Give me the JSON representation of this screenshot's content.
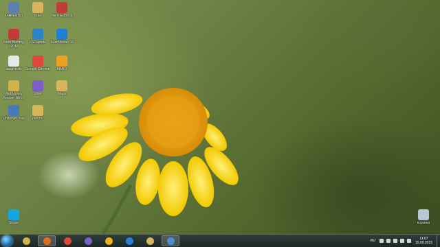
{
  "desktop": {
    "icons": [
      {
        "label": "Компьютер",
        "icon": "computer-icon",
        "color": "#5b7fb0"
      },
      {
        "label": "скан",
        "icon": "folder-icon",
        "color": "#d8b45a"
      },
      {
        "label": "Nero Express",
        "icon": "nero-icon",
        "color": "#c23b3b"
      },
      {
        "label": "Nero Burning ROM",
        "icon": "nero-burning-rom-icon",
        "color": "#c23b3b"
      },
      {
        "label": "FSCapture",
        "icon": "fscapture-icon",
        "color": "#2a86c9"
      },
      {
        "label": "TeamViewer 10",
        "icon": "teamviewer-icon",
        "color": "#1f7fd6"
      },
      {
        "label": "задачи.txt",
        "icon": "text-file-icon",
        "color": "#e8e8e8"
      },
      {
        "label": "Google Chrome",
        "icon": "chrome-icon",
        "color": "#e0463a"
      },
      {
        "label": "AIMP3",
        "icon": "aimp-icon",
        "color": "#f0a020"
      },
      {
        "label": "WebMoney Keeper Win...",
        "icon": "webmoney-icon",
        "color": "#d2b04a"
      },
      {
        "label": "Viber",
        "icon": "viber-icon",
        "color": "#7b5ec6"
      },
      {
        "label": "Maps",
        "icon": "maps-icon",
        "color": "#d8b45a"
      },
      {
        "label": "Unknown Tool",
        "icon": "tool-icon",
        "color": "#4a78b8"
      },
      {
        "label": "работа",
        "icon": "folder-icon",
        "color": "#d8b45a"
      },
      {
        "label": "Skype",
        "icon": "skype-icon",
        "color": "#12a7e3"
      },
      {
        "label": "корзина",
        "icon": "recycle-bin-icon",
        "color": "#b8c7d3"
      }
    ]
  },
  "taskbar": {
    "apps": [
      {
        "name": "WebMoney",
        "icon": "webmoney-icon",
        "color": "#d2b04a",
        "active": false
      },
      {
        "name": "Firefox",
        "icon": "firefox-icon",
        "color": "#e66a1b",
        "active": true
      },
      {
        "name": "Google Chrome",
        "icon": "chrome-icon",
        "color": "#e0463a",
        "active": false
      },
      {
        "name": "Viber",
        "icon": "viber-icon",
        "color": "#7b5ec6",
        "active": false
      },
      {
        "name": "Messenger",
        "icon": "messenger-icon",
        "color": "#f0b020",
        "active": false
      },
      {
        "name": "Internet Explorer",
        "icon": "ie-icon",
        "color": "#2a7fd6",
        "active": false
      },
      {
        "name": "Explorer",
        "icon": "folder-icon",
        "color": "#d8b45a",
        "active": false
      },
      {
        "name": "Remote Desktop",
        "icon": "monitor-icon",
        "color": "#4f8fd1",
        "active": true
      }
    ],
    "tray": {
      "language": "RU",
      "time": "11:07",
      "date": "15.09.2015"
    }
  }
}
